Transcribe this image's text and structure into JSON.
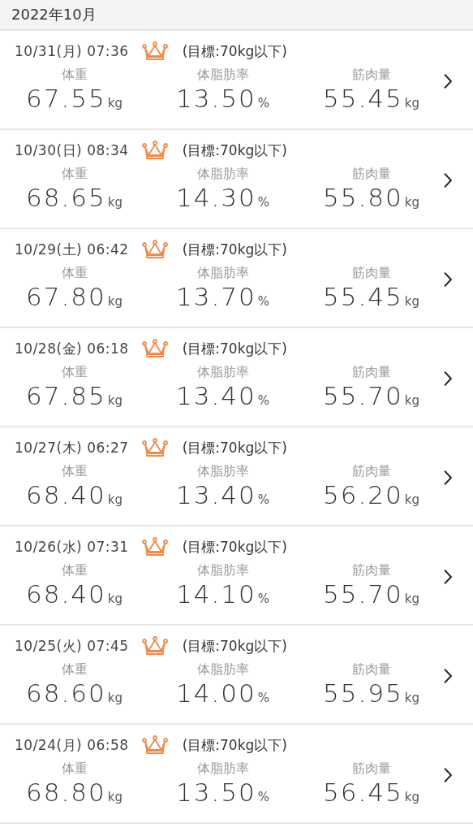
{
  "month_header": "2022年10月",
  "entries": [
    {
      "datetime": "10/31(月) 07:36",
      "crown": true,
      "goal": "(目標:70kg以下)",
      "metrics": [
        {
          "label": "体重",
          "value": "67.55",
          "unit": "kg"
        },
        {
          "label": "体脂肪率",
          "value": "13.50",
          "unit": "%"
        },
        {
          "label": "筋肉量",
          "value": "55.45",
          "unit": "kg"
        }
      ]
    },
    {
      "datetime": "10/30(日) 08:34",
      "crown": true,
      "goal": "(目標:70kg以下)",
      "metrics": [
        {
          "label": "体重",
          "value": "68.65",
          "unit": "kg"
        },
        {
          "label": "体脂肪率",
          "value": "14.30",
          "unit": "%"
        },
        {
          "label": "筋肉量",
          "value": "55.80",
          "unit": "kg"
        }
      ]
    },
    {
      "datetime": "10/29(土) 06:42",
      "crown": true,
      "goal": "(目標:70kg以下)",
      "metrics": [
        {
          "label": "体重",
          "value": "67.80",
          "unit": "kg"
        },
        {
          "label": "体脂肪率",
          "value": "13.70",
          "unit": "%"
        },
        {
          "label": "筋肉量",
          "value": "55.45",
          "unit": "kg"
        }
      ]
    },
    {
      "datetime": "10/28(金) 06:18",
      "crown": true,
      "goal": "(目標:70kg以下)",
      "metrics": [
        {
          "label": "体重",
          "value": "67.85",
          "unit": "kg"
        },
        {
          "label": "体脂肪率",
          "value": "13.40",
          "unit": "%"
        },
        {
          "label": "筋肉量",
          "value": "55.70",
          "unit": "kg"
        }
      ]
    },
    {
      "datetime": "10/27(木) 06:27",
      "crown": true,
      "goal": "(目標:70kg以下)",
      "metrics": [
        {
          "label": "体重",
          "value": "68.40",
          "unit": "kg"
        },
        {
          "label": "体脂肪率",
          "value": "13.40",
          "unit": "%"
        },
        {
          "label": "筋肉量",
          "value": "56.20",
          "unit": "kg"
        }
      ]
    },
    {
      "datetime": "10/26(水) 07:31",
      "crown": true,
      "goal": "(目標:70kg以下)",
      "metrics": [
        {
          "label": "体重",
          "value": "68.40",
          "unit": "kg"
        },
        {
          "label": "体脂肪率",
          "value": "14.10",
          "unit": "%"
        },
        {
          "label": "筋肉量",
          "value": "55.70",
          "unit": "kg"
        }
      ]
    },
    {
      "datetime": "10/25(火) 07:45",
      "crown": true,
      "goal": "(目標:70kg以下)",
      "metrics": [
        {
          "label": "体重",
          "value": "68.60",
          "unit": "kg"
        },
        {
          "label": "体脂肪率",
          "value": "14.00",
          "unit": "%"
        },
        {
          "label": "筋肉量",
          "value": "55.95",
          "unit": "kg"
        }
      ]
    },
    {
      "datetime": "10/24(月) 06:58",
      "crown": true,
      "goal": "(目標:70kg以下)",
      "metrics": [
        {
          "label": "体重",
          "value": "68.80",
          "unit": "kg"
        },
        {
          "label": "体脂肪率",
          "value": "13.50",
          "unit": "%"
        },
        {
          "label": "筋肉量",
          "value": "56.45",
          "unit": "kg"
        }
      ]
    }
  ]
}
